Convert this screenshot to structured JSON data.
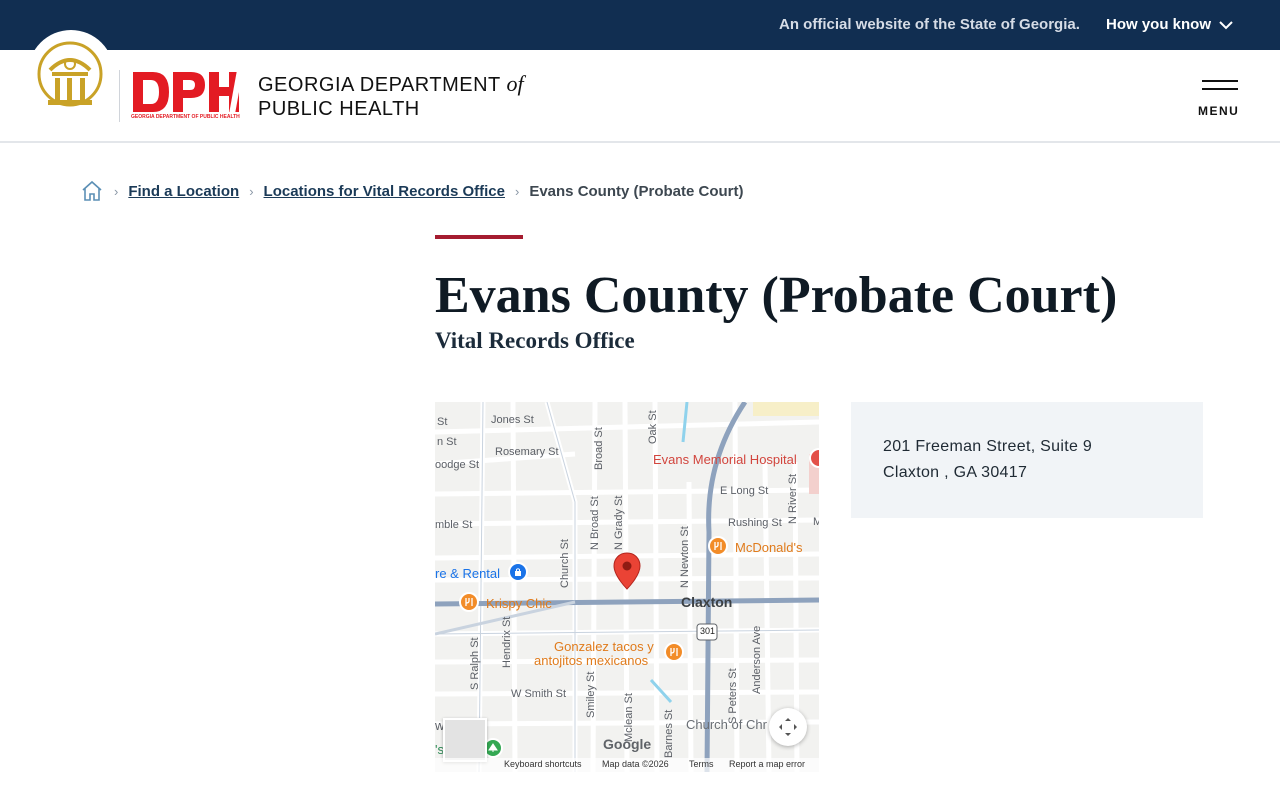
{
  "gov_bar": {
    "official_text": "An official website of the State of Georgia.",
    "how_you_know": "How you know"
  },
  "header": {
    "dph_logo_caption": "GEORGIA DEPARTMENT OF PUBLIC HEALTH",
    "agency_line1": "GEORGIA DEPARTMENT",
    "agency_of": "of",
    "agency_line2": "PUBLIC HEALTH",
    "menu_label": "MENU"
  },
  "breadcrumb": {
    "items": [
      "Find a Location",
      "Locations for Vital Records Office"
    ],
    "current": "Evans County (Probate Court)"
  },
  "page": {
    "title": "Evans County (Probate Court)",
    "subtitle": "Vital Records Office"
  },
  "map": {
    "town": "Claxton",
    "streets": [
      "Jones St",
      "Rosemary St",
      "Broad St",
      "Oak St",
      "E Long St",
      "N River St",
      "Rushing St",
      "N Broad St",
      "N Grady St",
      "N Newton St",
      "Church St",
      "Hendrix St",
      "S Ralph St",
      "W Smith St",
      "Smiley St",
      "Mclean St",
      "Barnes St",
      "S Peters St",
      "Anderson Ave",
      "St",
      "n St",
      "oodge St",
      "mble St",
      "M"
    ],
    "pois": {
      "hospital": "Evans Memorial Hospital",
      "mcdonalds": "McDonald's",
      "rental": "re & Rental",
      "krispy": "Krispy Chic",
      "gonzalez_1": "Gonzalez tacos y",
      "gonzalez_2": "antojitos mexicanos",
      "church": "Church of Chr",
      "edge_w": "w",
      "edge_s": "'s"
    },
    "highway_shield": "301",
    "google_logo": "Google",
    "attribution": {
      "shortcuts": "Keyboard shortcuts",
      "map_data": "Map data ©2026",
      "terms": "Terms",
      "report": "Report a map error"
    }
  },
  "address": {
    "street": "201 Freeman Street, Suite 9",
    "city_state_zip": "Claxton , GA 30417"
  },
  "colors": {
    "gov_bar": "#112e51",
    "accent": "#a51c30",
    "dph_red": "#e31b23",
    "seal_gold": "#c9a227",
    "card_bg": "#f1f4f7"
  }
}
